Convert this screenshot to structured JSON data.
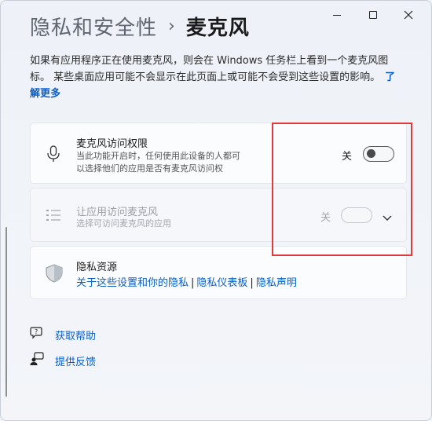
{
  "window": {
    "minimize_glyph": "—",
    "maximize_glyph": "▢",
    "close_glyph": "✕"
  },
  "breadcrumb": {
    "parent": "隐私和安全性",
    "separator": "›",
    "current": "麦克风"
  },
  "description": {
    "text": "如果有应用程序正在使用麦克风，则会在 Windows 任务栏上看到一个麦克风图标。 某些桌面应用可能不会显示在此页面上或可能不会受到这些设置的影响。",
    "learn_more": "了解更多"
  },
  "mic_access": {
    "title": "麦克风访问权限",
    "subtitle_line1": "当此功能开启时，任何使用此设备的人都可",
    "subtitle_line2": "以选择他们的应用是否有麦克风访问权",
    "state_label": "关",
    "enabled": false,
    "icon": "microphone-icon"
  },
  "app_access": {
    "title": "让应用访问麦克风",
    "subtitle": "选择可访问麦克风的应用",
    "state_label": "关",
    "enabled": false,
    "disabled": true,
    "icon": "list-icon"
  },
  "privacy_resources": {
    "title": "隐私资源",
    "links": [
      "关于这些设置和你的隐私",
      "隐私仪表板",
      "隐私声明"
    ],
    "link_separator": "|",
    "icon": "shield-icon"
  },
  "help": {
    "get_help": "获取帮助",
    "feedback": "提供反馈"
  },
  "colors": {
    "accent": "#0a5ec9",
    "highlight_box": "#e23a3a"
  }
}
